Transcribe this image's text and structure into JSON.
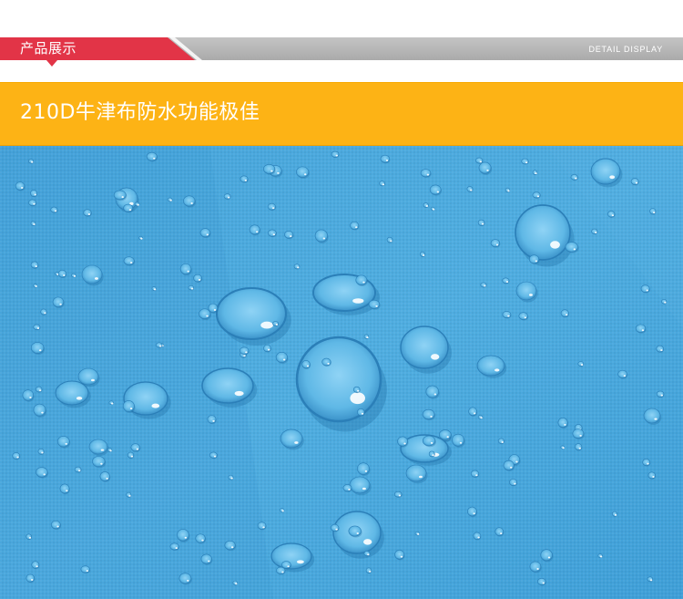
{
  "section_header": {
    "title": "产品展示",
    "subtitle": "DETAIL  DISPLAY",
    "accent_color": "#e23447",
    "bar_color": "#b3b3b3"
  },
  "feature_banner": {
    "text": "210D牛津布防水功能极佳",
    "background_color": "#fdb315"
  },
  "product_photo": {
    "subject": "water-droplets-on-blue-oxford-fabric",
    "fabric_color": "#4aa8dc"
  }
}
